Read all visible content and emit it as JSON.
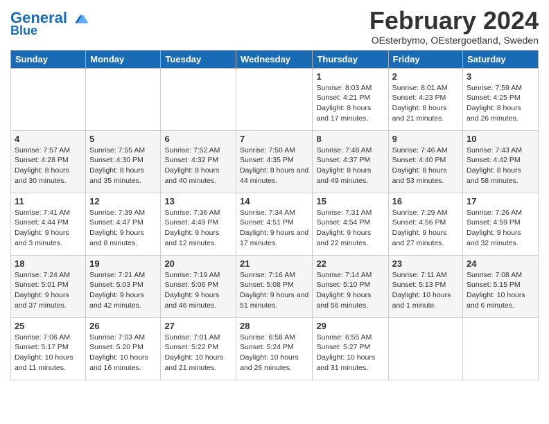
{
  "logo": {
    "line1": "General",
    "line2": "Blue"
  },
  "title": "February 2024",
  "subtitle": "OEsterbymo, OEstergoetland, Sweden",
  "days_of_week": [
    "Sunday",
    "Monday",
    "Tuesday",
    "Wednesday",
    "Thursday",
    "Friday",
    "Saturday"
  ],
  "weeks": [
    [
      {
        "day": "",
        "info": ""
      },
      {
        "day": "",
        "info": ""
      },
      {
        "day": "",
        "info": ""
      },
      {
        "day": "",
        "info": ""
      },
      {
        "day": "1",
        "info": "Sunrise: 8:03 AM\nSunset: 4:21 PM\nDaylight: 8 hours and 17 minutes."
      },
      {
        "day": "2",
        "info": "Sunrise: 8:01 AM\nSunset: 4:23 PM\nDaylight: 8 hours and 21 minutes."
      },
      {
        "day": "3",
        "info": "Sunrise: 7:59 AM\nSunset: 4:25 PM\nDaylight: 8 hours and 26 minutes."
      }
    ],
    [
      {
        "day": "4",
        "info": "Sunrise: 7:57 AM\nSunset: 4:28 PM\nDaylight: 8 hours and 30 minutes."
      },
      {
        "day": "5",
        "info": "Sunrise: 7:55 AM\nSunset: 4:30 PM\nDaylight: 8 hours and 35 minutes."
      },
      {
        "day": "6",
        "info": "Sunrise: 7:52 AM\nSunset: 4:32 PM\nDaylight: 8 hours and 40 minutes."
      },
      {
        "day": "7",
        "info": "Sunrise: 7:50 AM\nSunset: 4:35 PM\nDaylight: 8 hours and 44 minutes."
      },
      {
        "day": "8",
        "info": "Sunrise: 7:48 AM\nSunset: 4:37 PM\nDaylight: 8 hours and 49 minutes."
      },
      {
        "day": "9",
        "info": "Sunrise: 7:46 AM\nSunset: 4:40 PM\nDaylight: 8 hours and 53 minutes."
      },
      {
        "day": "10",
        "info": "Sunrise: 7:43 AM\nSunset: 4:42 PM\nDaylight: 8 hours and 58 minutes."
      }
    ],
    [
      {
        "day": "11",
        "info": "Sunrise: 7:41 AM\nSunset: 4:44 PM\nDaylight: 9 hours and 3 minutes."
      },
      {
        "day": "12",
        "info": "Sunrise: 7:39 AM\nSunset: 4:47 PM\nDaylight: 9 hours and 8 minutes."
      },
      {
        "day": "13",
        "info": "Sunrise: 7:36 AM\nSunset: 4:49 PM\nDaylight: 9 hours and 12 minutes."
      },
      {
        "day": "14",
        "info": "Sunrise: 7:34 AM\nSunset: 4:51 PM\nDaylight: 9 hours and 17 minutes."
      },
      {
        "day": "15",
        "info": "Sunrise: 7:31 AM\nSunset: 4:54 PM\nDaylight: 9 hours and 22 minutes."
      },
      {
        "day": "16",
        "info": "Sunrise: 7:29 AM\nSunset: 4:56 PM\nDaylight: 9 hours and 27 minutes."
      },
      {
        "day": "17",
        "info": "Sunrise: 7:26 AM\nSunset: 4:59 PM\nDaylight: 9 hours and 32 minutes."
      }
    ],
    [
      {
        "day": "18",
        "info": "Sunrise: 7:24 AM\nSunset: 5:01 PM\nDaylight: 9 hours and 37 minutes."
      },
      {
        "day": "19",
        "info": "Sunrise: 7:21 AM\nSunset: 5:03 PM\nDaylight: 9 hours and 42 minutes."
      },
      {
        "day": "20",
        "info": "Sunrise: 7:19 AM\nSunset: 5:06 PM\nDaylight: 9 hours and 46 minutes."
      },
      {
        "day": "21",
        "info": "Sunrise: 7:16 AM\nSunset: 5:08 PM\nDaylight: 9 hours and 51 minutes."
      },
      {
        "day": "22",
        "info": "Sunrise: 7:14 AM\nSunset: 5:10 PM\nDaylight: 9 hours and 56 minutes."
      },
      {
        "day": "23",
        "info": "Sunrise: 7:11 AM\nSunset: 5:13 PM\nDaylight: 10 hours and 1 minute."
      },
      {
        "day": "24",
        "info": "Sunrise: 7:08 AM\nSunset: 5:15 PM\nDaylight: 10 hours and 6 minutes."
      }
    ],
    [
      {
        "day": "25",
        "info": "Sunrise: 7:06 AM\nSunset: 5:17 PM\nDaylight: 10 hours and 11 minutes."
      },
      {
        "day": "26",
        "info": "Sunrise: 7:03 AM\nSunset: 5:20 PM\nDaylight: 10 hours and 16 minutes."
      },
      {
        "day": "27",
        "info": "Sunrise: 7:01 AM\nSunset: 5:22 PM\nDaylight: 10 hours and 21 minutes."
      },
      {
        "day": "28",
        "info": "Sunrise: 6:58 AM\nSunset: 5:24 PM\nDaylight: 10 hours and 26 minutes."
      },
      {
        "day": "29",
        "info": "Sunrise: 6:55 AM\nSunset: 5:27 PM\nDaylight: 10 hours and 31 minutes."
      },
      {
        "day": "",
        "info": ""
      },
      {
        "day": "",
        "info": ""
      }
    ]
  ]
}
